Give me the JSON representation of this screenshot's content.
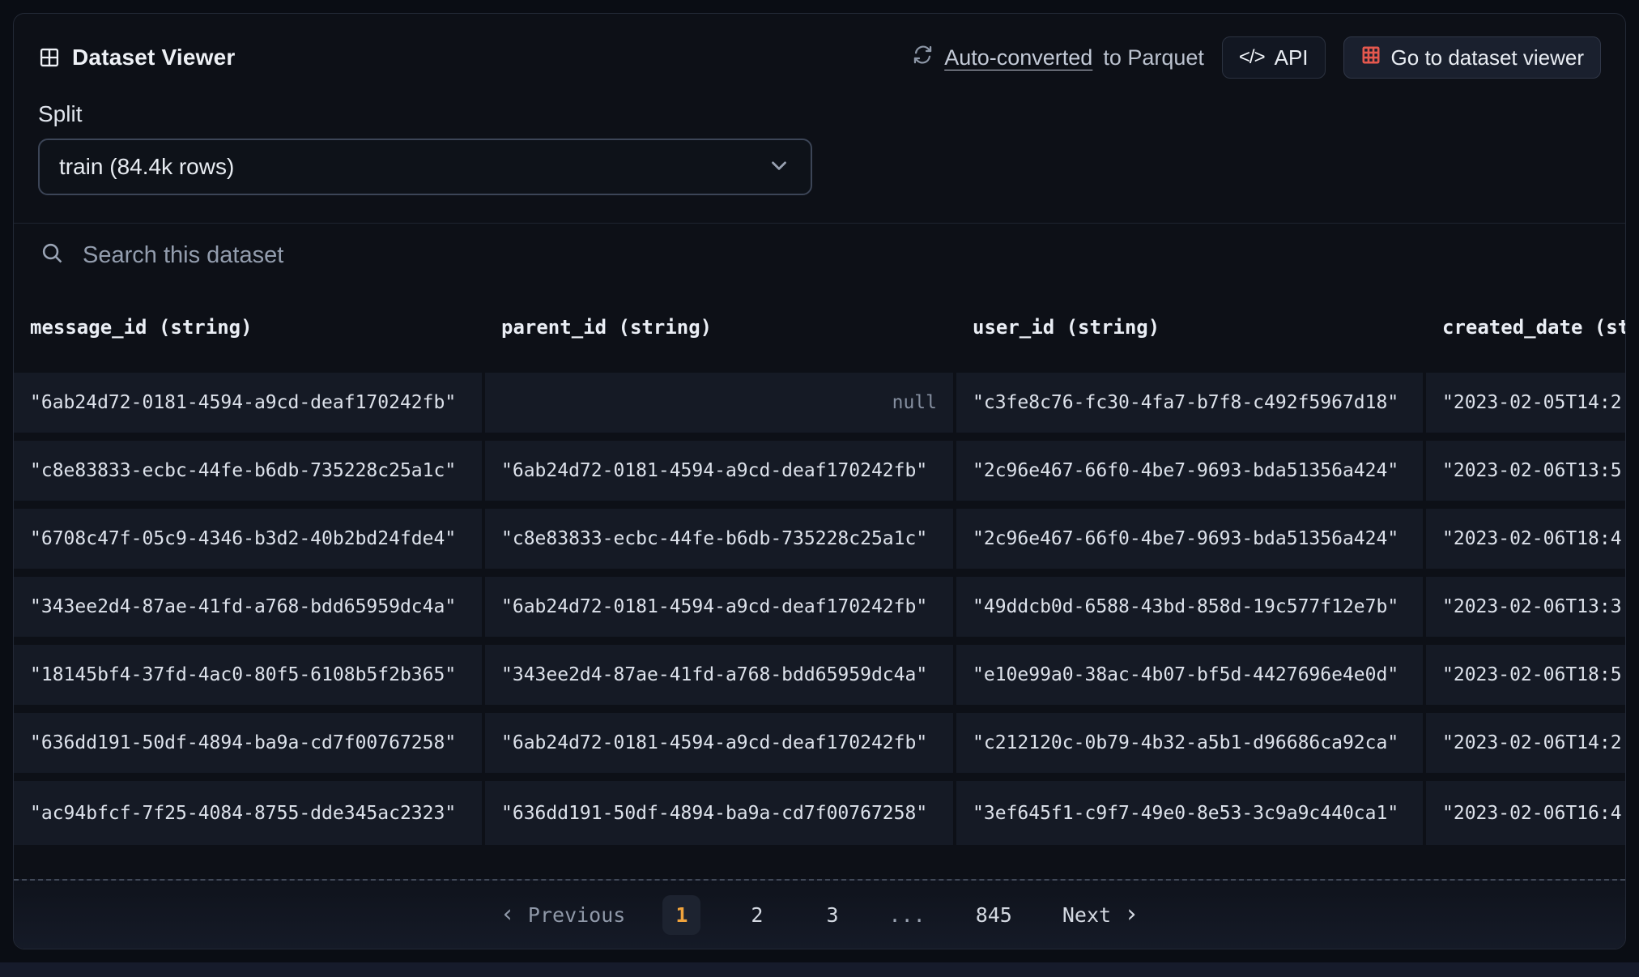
{
  "colors": {
    "accent_orange": "#F0A33C",
    "viewer_icon_red": "#E5584E",
    "card_background": "#0D1017",
    "row_background": "#151A25",
    "page_background": "#0A0D14"
  },
  "icons": {
    "dataset_viewer": "2x2-table-grid",
    "refresh": "circular-arrows",
    "api": "code-brackets",
    "go_to_viewer": "3x3-red-grid",
    "search": "magnifier",
    "select_chevron": "chevron-down"
  },
  "header": {
    "title": "Dataset Viewer",
    "auto_converted_link": "Auto-converted",
    "auto_converted_rest": "to Parquet",
    "api_icon_glyph": "</>",
    "api_button": "API",
    "viewer_button": "Go to dataset viewer"
  },
  "split": {
    "label": "Split",
    "selected_option": "train (84.4k rows)"
  },
  "search": {
    "placeholder": "Search this dataset"
  },
  "table": {
    "columns": [
      "message_id (string)",
      "parent_id (string)",
      "user_id (string)",
      "created_date (st"
    ],
    "rows": [
      {
        "message_id": "\"6ab24d72-0181-4594-a9cd-deaf170242fb\"",
        "parent_id": "null",
        "user_id": "\"c3fe8c76-fc30-4fa7-b7f8-c492f5967d18\"",
        "created_date": "\"2023-02-05T14:2"
      },
      {
        "message_id": "\"c8e83833-ecbc-44fe-b6db-735228c25a1c\"",
        "parent_id": "\"6ab24d72-0181-4594-a9cd-deaf170242fb\"",
        "user_id": "\"2c96e467-66f0-4be7-9693-bda51356a424\"",
        "created_date": "\"2023-02-06T13:5"
      },
      {
        "message_id": "\"6708c47f-05c9-4346-b3d2-40b2bd24fde4\"",
        "parent_id": "\"c8e83833-ecbc-44fe-b6db-735228c25a1c\"",
        "user_id": "\"2c96e467-66f0-4be7-9693-bda51356a424\"",
        "created_date": "\"2023-02-06T18:4"
      },
      {
        "message_id": "\"343ee2d4-87ae-41fd-a768-bdd65959dc4a\"",
        "parent_id": "\"6ab24d72-0181-4594-a9cd-deaf170242fb\"",
        "user_id": "\"49ddcb0d-6588-43bd-858d-19c577f12e7b\"",
        "created_date": "\"2023-02-06T13:3"
      },
      {
        "message_id": "\"18145bf4-37fd-4ac0-80f5-6108b5f2b365\"",
        "parent_id": "\"343ee2d4-87ae-41fd-a768-bdd65959dc4a\"",
        "user_id": "\"e10e99a0-38ac-4b07-bf5d-4427696e4e0d\"",
        "created_date": "\"2023-02-06T18:5"
      },
      {
        "message_id": "\"636dd191-50df-4894-ba9a-cd7f00767258\"",
        "parent_id": "\"6ab24d72-0181-4594-a9cd-deaf170242fb\"",
        "user_id": "\"c212120c-0b79-4b32-a5b1-d96686ca92ca\"",
        "created_date": "\"2023-02-06T14:2"
      },
      {
        "message_id": "\"ac94bfcf-7f25-4084-8755-dde345ac2323\"",
        "parent_id": "\"636dd191-50df-4894-ba9a-cd7f00767258\"",
        "user_id": "\"3ef645f1-c9f7-49e0-8e53-3c9a9c440ca1\"",
        "created_date": "\"2023-02-06T16:4"
      }
    ]
  },
  "pagination": {
    "prev_chevron": "‹",
    "previous_label": "Previous",
    "pages": [
      "1",
      "2",
      "3",
      "...",
      "845"
    ],
    "current_page": "1",
    "next_label": "Next",
    "next_chevron": "›"
  }
}
